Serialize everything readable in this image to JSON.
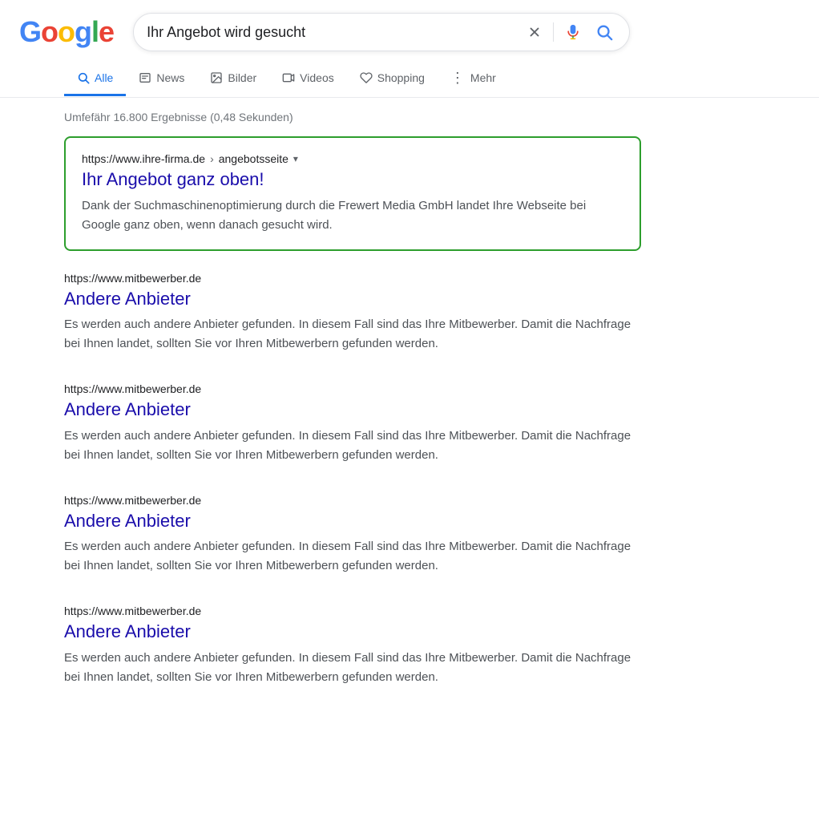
{
  "header": {
    "search_query": "Ihr Angebot wird gesucht",
    "search_placeholder": "Ihr Angebot wird gesucht"
  },
  "nav": {
    "tabs": [
      {
        "id": "alle",
        "label": "Alle",
        "active": true,
        "icon": "🔍"
      },
      {
        "id": "news",
        "label": "News",
        "active": false,
        "icon": "📰"
      },
      {
        "id": "bilder",
        "label": "Bilder",
        "active": false,
        "icon": "🖼"
      },
      {
        "id": "videos",
        "label": "Videos",
        "active": false,
        "icon": "▶"
      },
      {
        "id": "shopping",
        "label": "Shopping",
        "active": false,
        "icon": "🏷"
      },
      {
        "id": "mehr",
        "label": "Mehr",
        "active": false,
        "icon": "⋮"
      }
    ]
  },
  "results_info": "Umfefähr 16.800 Ergebnisse (0,48 Sekunden)",
  "featured_result": {
    "url": "https://www.ihre-firma.de",
    "breadcrumb": "angebotsseite",
    "title": "Ihr Angebot ganz oben!",
    "snippet": "Dank der Suchmaschinenoptimierung durch die Frewert Media GmbH landet Ihre Webseite bei Google ganz oben, wenn danach gesucht wird."
  },
  "other_results": [
    {
      "url": "https://www.mitbewerber.de",
      "title": "Andere Anbieter",
      "snippet": "Es werden auch andere Anbieter gefunden. In diesem Fall sind das Ihre Mitbewerber. Damit die Nachfrage bei Ihnen landet, sollten Sie vor Ihren Mitbewerbern gefunden werden."
    },
    {
      "url": "https://www.mitbewerber.de",
      "title": "Andere Anbieter",
      "snippet": "Es werden auch andere Anbieter gefunden. In diesem Fall sind das Ihre Mitbewerber. Damit die Nachfrage bei Ihnen landet, sollten Sie vor Ihren Mitbewerbern gefunden werden."
    },
    {
      "url": "https://www.mitbewerber.de",
      "title": "Andere Anbieter",
      "snippet": "Es werden auch andere Anbieter gefunden. In diesem Fall sind das Ihre Mitbewerber. Damit die Nachfrage bei Ihnen landet, sollten Sie vor Ihren Mitbewerbern gefunden werden."
    },
    {
      "url": "https://www.mitbewerber.de",
      "title": "Andere Anbieter",
      "snippet": "Es werden auch andere Anbieter gefunden. In diesem Fall sind das Ihre Mitbewerber. Damit die Nachfrage bei Ihnen landet, sollten Sie vor Ihren Mitbewerbern gefunden werden."
    }
  ],
  "colors": {
    "google_blue": "#4285F4",
    "google_red": "#EA4335",
    "google_yellow": "#FBBC05",
    "google_green": "#34A853",
    "featured_border": "#2d9e2d",
    "link_color": "#1a0dab",
    "competitor_link": "#1a0dab"
  }
}
